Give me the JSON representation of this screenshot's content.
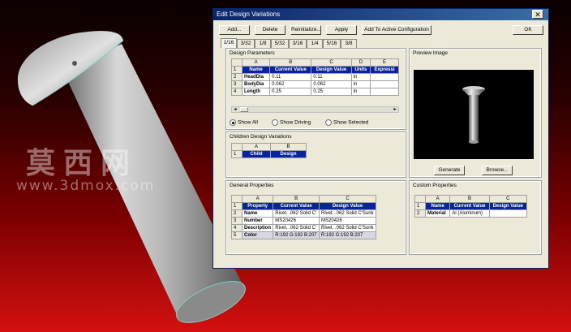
{
  "dialog": {
    "title": "Edit Design Variations",
    "close_glyph": "✕",
    "buttons": {
      "add": "Add...",
      "delete": "Delete",
      "reinitialize": "Reinitialize...",
      "apply": "Apply",
      "add_to_active": "Add To Active Configuration",
      "ok": "OK"
    },
    "tabs": [
      "1/16",
      "3/32",
      "1/8",
      "5/32",
      "3/16",
      "1/4",
      "5/16",
      "3/8"
    ],
    "active_tab": "1/16"
  },
  "design_parameters": {
    "title": "Design Parameters",
    "col_letters": [
      "",
      "A",
      "B",
      "C",
      "D",
      "E"
    ],
    "rows": [
      [
        "1",
        "Name",
        "Current Value",
        "Design Value",
        "Units",
        "Expressi"
      ],
      [
        "2",
        "HeadDia",
        "0.11",
        "0.11",
        "in",
        ""
      ],
      [
        "3",
        "BodyDia",
        "0.062",
        "0.062",
        "in",
        ""
      ],
      [
        "4",
        "Length",
        "0.25",
        "0.25",
        "in",
        ""
      ]
    ],
    "scroll_left": "◂",
    "scroll_right": "▸",
    "radios": [
      {
        "label": "Show All",
        "selected": true
      },
      {
        "label": "Show Driving",
        "selected": false
      },
      {
        "label": "Show Selected",
        "selected": false
      }
    ]
  },
  "children": {
    "title": "Children Design Variations",
    "col_letters": [
      "",
      "A",
      "B"
    ],
    "rows": [
      [
        "1",
        "Child",
        "Design"
      ]
    ]
  },
  "preview": {
    "title": "Preview Image",
    "generate": "Generate",
    "browse": "Browse..."
  },
  "general_properties": {
    "title": "General Properties",
    "col_letters": [
      "",
      "A",
      "B",
      "C"
    ],
    "rows": [
      [
        "1",
        "Property",
        "Current Value",
        "Design Value"
      ],
      [
        "2",
        "Name",
        "Rivet, .062 Solid C'",
        "Rivet, .062 Solid C'Sunk"
      ],
      [
        "3",
        "Number",
        "MS20426",
        "MS20426"
      ],
      [
        "4",
        "Description",
        "Rivet, .062 Solid C'",
        "Rivet, .062 Solid C'Sunk"
      ],
      [
        "5",
        "Color",
        "R:192 G:192 B:207",
        "R:192 G:192 B:207"
      ]
    ]
  },
  "custom_properties": {
    "title": "Custom Properties",
    "col_letters": [
      "",
      "A",
      "B",
      "C"
    ],
    "rows": [
      [
        "1",
        "Name",
        "Current Value",
        "Design Value"
      ],
      [
        "2",
        "Material",
        "Al (Aluminum)",
        ""
      ]
    ]
  },
  "watermark": {
    "line1": "莫西网",
    "line2": "www.3dmox.com"
  },
  "colors": {
    "title_bar": "#0a246a",
    "header_blue": "#0a24a0",
    "background_red": "#d41010",
    "dialog_face": "#ece9d8"
  }
}
